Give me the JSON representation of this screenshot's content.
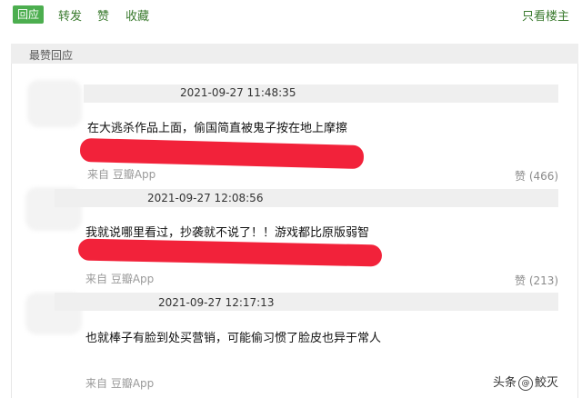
{
  "toolbar": {
    "reply": "回应",
    "repost": "转发",
    "like": "赞",
    "favorite": "收藏",
    "only_op": "只看楼主"
  },
  "section": {
    "title": "最赞回应"
  },
  "comments": [
    {
      "time": "2021-09-27 11:48:35",
      "text": "在大逃杀作品上面，偷国简直被鬼子按在地上摩擦",
      "source": "来自  豆瓣App",
      "likes": "赞 (466)"
    },
    {
      "time": "2021-09-27 12:08:56",
      "text": "我就说哪里看过，抄袭就不说了！！游戏都比原版弱智",
      "source": "来自  豆瓣App",
      "likes": "赞 (213)"
    },
    {
      "time": "2021-09-27 12:17:13",
      "text": "也就棒子有脸到处买营销，可能偷习惯了脸皮也异于常人",
      "source": "来自  豆瓣App",
      "likes": ""
    }
  ],
  "watermark": {
    "prefix": "头条",
    "mark": "@",
    "name": "鮫灭"
  },
  "colors": {
    "accent": "#4cae4f",
    "redaction": "#f2223a",
    "link": "#3a7a2e"
  }
}
